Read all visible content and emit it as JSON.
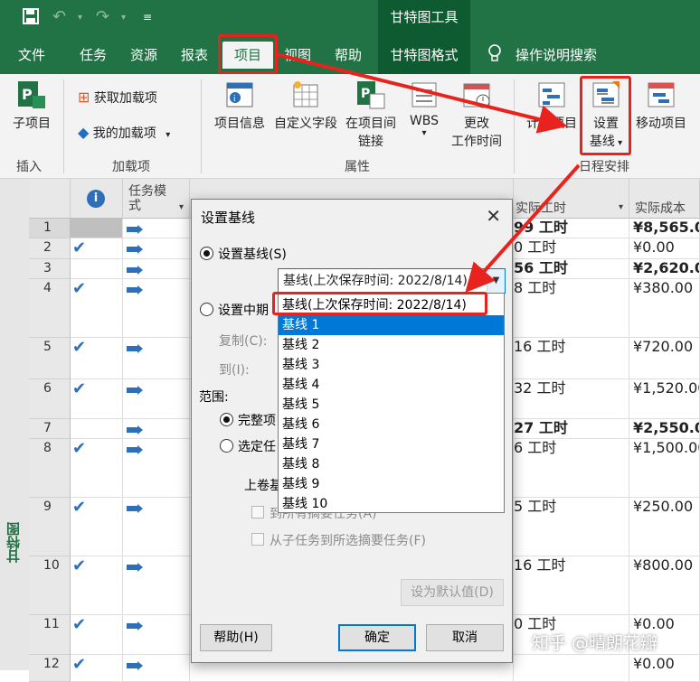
{
  "titlebar": {
    "context_tools": "甘特图工具"
  },
  "tabs": [
    {
      "label": "文件"
    },
    {
      "label": "任务"
    },
    {
      "label": "资源"
    },
    {
      "label": "报表"
    },
    {
      "label": "项目"
    },
    {
      "label": "视图"
    },
    {
      "label": "帮助"
    },
    {
      "label": "甘特图格式"
    },
    {
      "label": "操作说明搜索"
    }
  ],
  "ribbon": {
    "subproject": "子项目",
    "get_addins": "获取加载项",
    "my_addins": "我的加载项",
    "project_info": "项目信息",
    "custom_fields": "自定义字段",
    "links_line1": "在项目间",
    "links_line2": "链接",
    "wbs": "WBS",
    "change_worktime_line1": "更改",
    "change_worktime_line2": "工作时间",
    "calc_project": "计算项目",
    "set_baseline_line1": "设置",
    "set_baseline_line2": "基线",
    "move_project": "移动项目",
    "groups": {
      "insert": "插入",
      "addins": "加载项",
      "properties": "属性",
      "schedule": "日程安排"
    }
  },
  "sheet": {
    "sidebar_label": "甘特图",
    "headers": {
      "info": "i",
      "task_mode": "任务模式",
      "actual_work": "实际工时",
      "actual_cost": "实际成本"
    },
    "rows": [
      {
        "num": "1",
        "work": "99 工时",
        "cost": "¥8,565.00",
        "bold": true
      },
      {
        "num": "2",
        "work": "0 工时",
        "cost": "¥0.00",
        "bold": false
      },
      {
        "num": "3",
        "work": "56 工时",
        "cost": "¥2,620.00",
        "bold": true
      },
      {
        "num": "4",
        "work": "8 工时",
        "cost": "¥380.00",
        "bold": false
      },
      {
        "num": "5",
        "work": "16 工时",
        "cost": "¥720.00",
        "bold": false
      },
      {
        "num": "6",
        "work": "32 工时",
        "cost": "¥1,520.00",
        "bold": false
      },
      {
        "num": "7",
        "work": "27 工时",
        "cost": "¥2,550.00",
        "bold": true
      },
      {
        "num": "8",
        "work": "6 工时",
        "cost": "¥1,500.00",
        "bold": false
      },
      {
        "num": "9",
        "work": "5 工时",
        "cost": "¥250.00",
        "bold": false
      },
      {
        "num": "10",
        "work": "16 工时",
        "cost": "¥800.00",
        "bold": false
      },
      {
        "num": "11",
        "work": "0 工时",
        "cost": "¥0.00",
        "bold": false
      },
      {
        "num": "12",
        "work": "",
        "cost": "¥0.00",
        "bold": false
      }
    ]
  },
  "dialog": {
    "title": "设置基线",
    "opt_set_baseline": "设置基线(S)",
    "combo_value": "基线(上次保存时间: 2022/8/14)",
    "opt_set_interim": "设置中期",
    "copy_label": "复制(C):",
    "to_label": "到(I):",
    "scope_label": "范围:",
    "opt_entire": "完整项",
    "opt_selected": "选定任",
    "rollup_label": "上卷基",
    "chk_to_summary": "到所有摘要任务(A)",
    "chk_from_sub": "从子任务到所选摘要任务(F)",
    "set_default": "设为默认值(D)",
    "help": "帮助(H)",
    "ok": "确定",
    "cancel": "取消",
    "dropdown": [
      "基线(上次保存时间: 2022/8/14)",
      "基线 1",
      "基线 2",
      "基线 3",
      "基线 4",
      "基线 5",
      "基线 6",
      "基线 7",
      "基线 8",
      "基线 9",
      "基线 10"
    ],
    "selected_index": 1
  },
  "watermark": "知乎 @晴朗花瓣",
  "colors": {
    "brand_green": "#217346",
    "highlight_red": "#e8231e",
    "selection_blue": "#0078d7"
  }
}
